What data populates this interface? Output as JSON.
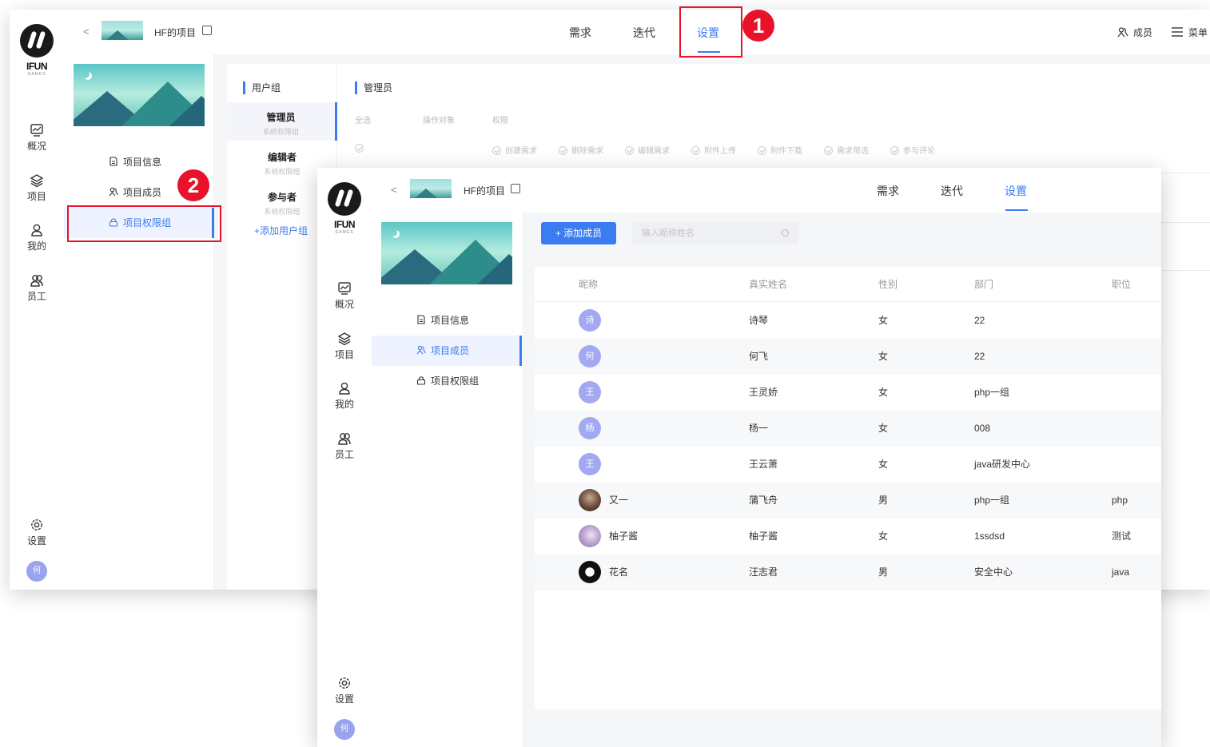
{
  "colors": {
    "accent": "#3b7cf1",
    "annotation": "#e8132a",
    "avatar": "#a2a9f0"
  },
  "brand": {
    "logo_text": "IFUN",
    "logo_sub": "GAMES"
  },
  "rail": {
    "items": [
      {
        "label": "概况",
        "icon": "overview-icon"
      },
      {
        "label": "项目",
        "icon": "layers-icon"
      },
      {
        "label": "我的",
        "icon": "user-icon"
      },
      {
        "label": "员工",
        "icon": "users-icon"
      }
    ],
    "settings_label": "设置",
    "avatar_char": "何"
  },
  "header": {
    "back": "<",
    "project_name": "HF的项目",
    "tabs": [
      "需求",
      "迭代",
      "设置"
    ],
    "active_tab": "设置",
    "right_members": "成员",
    "right_menu": "菜单"
  },
  "side_menu": [
    "项目信息",
    "项目成员",
    "项目权限组"
  ],
  "window_a": {
    "user_group_title": "用户组",
    "groups": [
      {
        "name": "管理员",
        "desc": "系统权限组"
      },
      {
        "name": "编辑者",
        "desc": "系统权限组"
      },
      {
        "name": "参与者",
        "desc": "系统权限组"
      }
    ],
    "add_group": "+添加用户组",
    "permission_title": "管理员",
    "perm_columns": [
      "全选",
      "操作对象",
      "权限"
    ],
    "permissions": [
      "创建需求",
      "删除需求",
      "编辑需求",
      "附件上传",
      "附件下载",
      "需求筛选",
      "参与评论"
    ]
  },
  "annotations": [
    "1",
    "2"
  ],
  "window_b": {
    "add_member_button": "+ 添加成员",
    "search_placeholder": "输入昵称姓名",
    "columns": [
      "昵称",
      "真实姓名",
      "性别",
      "部门",
      "职位"
    ],
    "members": [
      {
        "avatar": "诗",
        "nickname": "",
        "real_name": "诗琴",
        "gender": "女",
        "dept": "22",
        "position": ""
      },
      {
        "avatar": "何",
        "nickname": "",
        "real_name": "何飞",
        "gender": "女",
        "dept": "22",
        "position": ""
      },
      {
        "avatar": "王",
        "nickname": "",
        "real_name": "王灵娇",
        "gender": "女",
        "dept": "php一组",
        "position": ""
      },
      {
        "avatar": "杨",
        "nickname": "",
        "real_name": "杨一",
        "gender": "女",
        "dept": "008",
        "position": ""
      },
      {
        "avatar": "王",
        "nickname": "",
        "real_name": "王云萧",
        "gender": "女",
        "dept": "java研发中心",
        "position": ""
      },
      {
        "avatar": "",
        "nickname": "又一",
        "real_name": "蒲飞舟",
        "gender": "男",
        "dept": "php一组",
        "position": "php"
      },
      {
        "avatar": "",
        "nickname": "柚子酱",
        "real_name": "柚子酱",
        "gender": "女",
        "dept": "1ssdsd",
        "position": "测试"
      },
      {
        "avatar": "",
        "nickname": "花名",
        "real_name": "汪志君",
        "gender": "男",
        "dept": "安全中心",
        "position": "java"
      }
    ]
  }
}
